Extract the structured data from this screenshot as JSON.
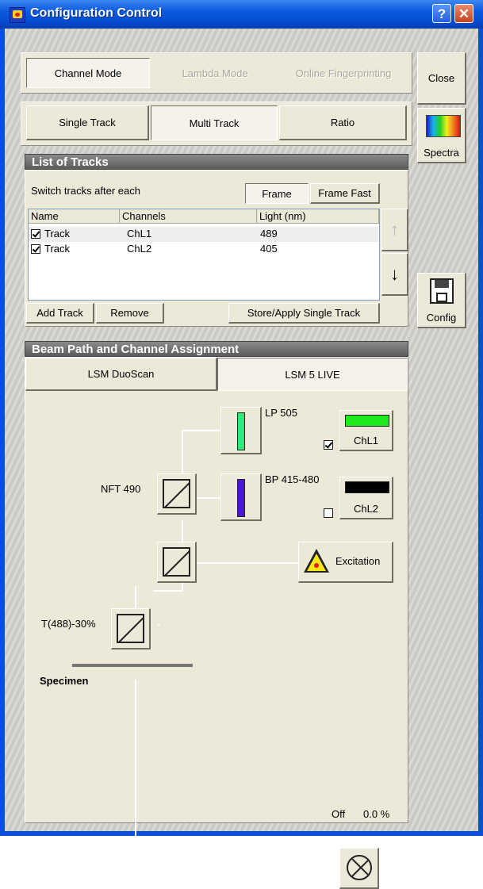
{
  "window": {
    "title": "Configuration Control",
    "help": "?",
    "close": "✕"
  },
  "mode_tabs": {
    "channel": "Channel Mode",
    "lambda": "Lambda Mode",
    "online": "Online Fingerprinting"
  },
  "track_tabs": {
    "single": "Single Track",
    "multi": "Multi Track",
    "ratio": "Ratio"
  },
  "side": {
    "close": "Close",
    "spectra": "Spectra",
    "config": "Config"
  },
  "tracks": {
    "header": "List of Tracks",
    "switch_label": "Switch tracks after each",
    "frame": "Frame",
    "frame_fast": "Frame Fast",
    "columns": [
      "Name",
      "Channels",
      "Light (nm)"
    ],
    "rows": [
      {
        "name": "Track",
        "channels": "ChL1",
        "light": "489",
        "checked": true
      },
      {
        "name": "Track",
        "channels": "ChL2",
        "light": "405",
        "checked": true
      }
    ],
    "up_arrow": "↑",
    "down_arrow": "↓",
    "add": "Add Track",
    "remove": "Remove",
    "store": "Store/Apply Single Track"
  },
  "beam": {
    "header": "Beam Path and Channel Assignment",
    "tab_duoscan": "LSM DuoScan",
    "tab_live": "LSM 5 LIVE",
    "lp505": "LP 505",
    "bp": "BP 415-480",
    "nft": "NFT 490",
    "t488": "T(488)-30%",
    "excitation": "Excitation",
    "specimen": "Specimen",
    "chl1": "ChL1",
    "chl2": "ChL2",
    "chl1_checked": true,
    "chl2_checked": false,
    "off": "Off",
    "percent": "0.0 %",
    "colors": {
      "chl1": "#1ee81e",
      "chl2": "#000000",
      "lp_filter": "#2ee87a",
      "bp_filter": "#4a16d8"
    }
  }
}
